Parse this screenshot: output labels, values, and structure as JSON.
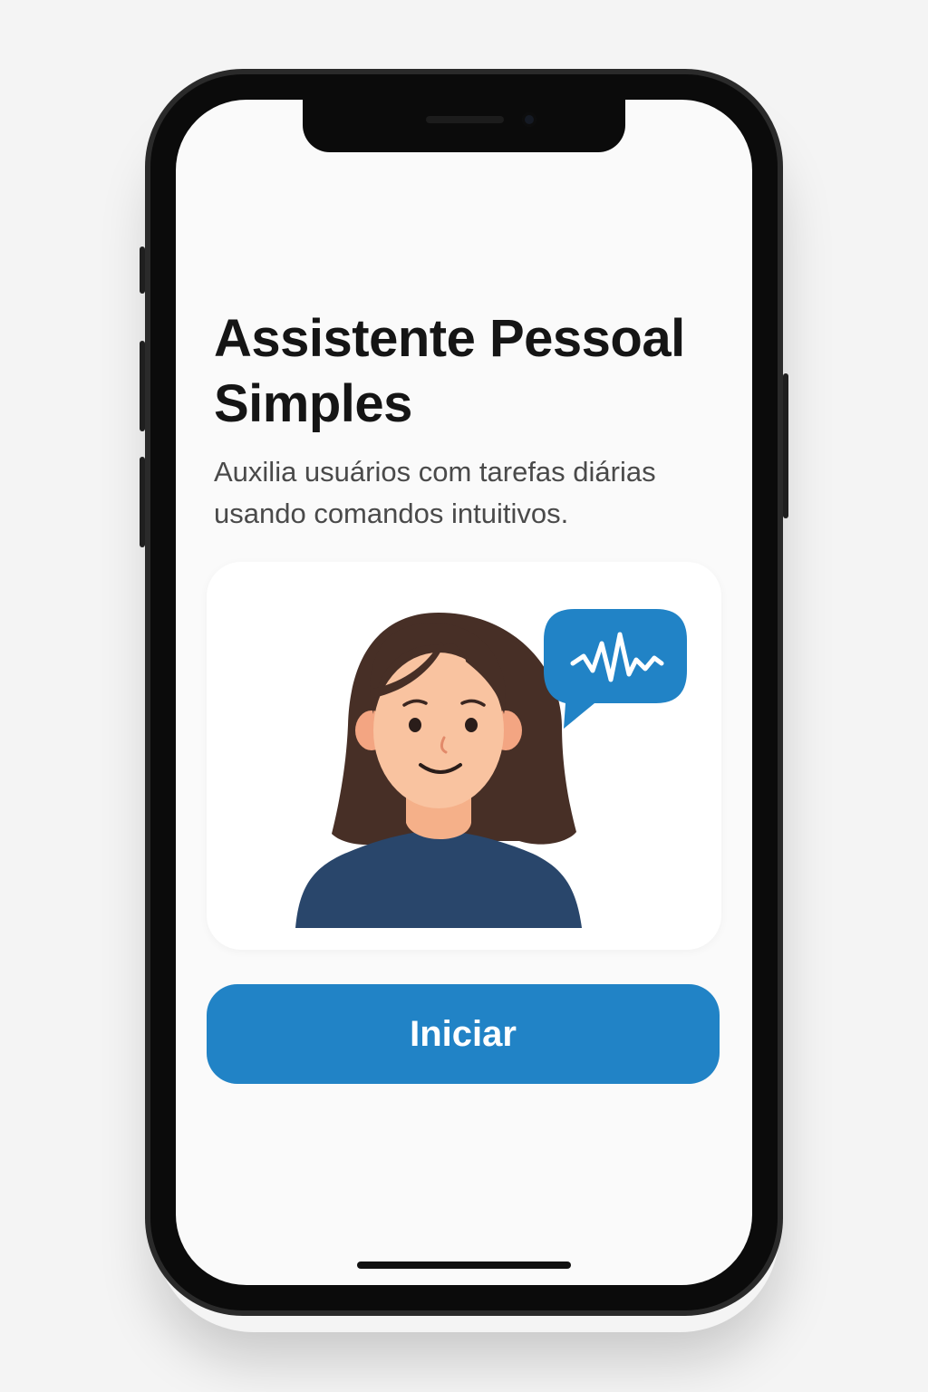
{
  "app": {
    "title": "Assistente Pessoal Simples",
    "subtitle": "Auxilia usuários com tarefas diárias usando comandos intuitivos."
  },
  "illustration": {
    "person_icon": "woman-avatar-icon",
    "bubble_icon": "voice-wave-icon"
  },
  "actions": {
    "start_label": "Iniciar"
  },
  "colors": {
    "accent": "#2183c6",
    "title_text": "#151515",
    "body_text": "#4a4a4a",
    "screen_bg": "#fafafa"
  }
}
